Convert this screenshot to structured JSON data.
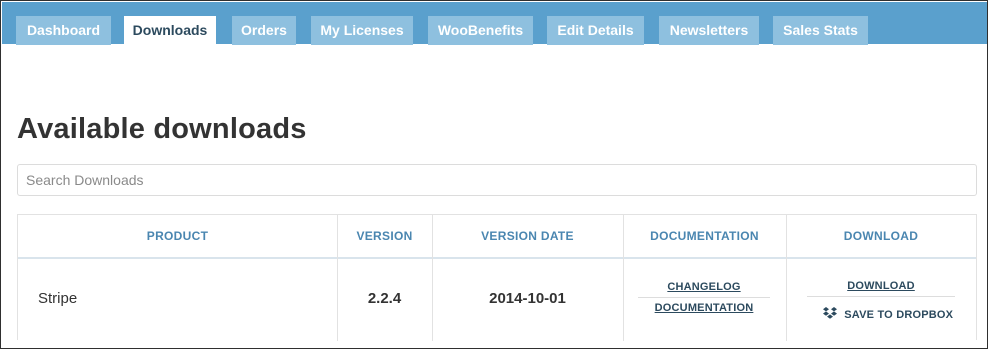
{
  "tabs": [
    {
      "label": "Dashboard"
    },
    {
      "label": "Downloads",
      "active": true
    },
    {
      "label": "Orders"
    },
    {
      "label": "My Licenses"
    },
    {
      "label": "WooBenefits"
    },
    {
      "label": "Edit Details"
    },
    {
      "label": "Newsletters"
    },
    {
      "label": "Sales Stats"
    }
  ],
  "page": {
    "title": "Available downloads"
  },
  "search": {
    "placeholder": "Search Downloads",
    "value": ""
  },
  "table": {
    "headers": {
      "product": "PRODUCT",
      "version": "VERSION",
      "version_date": "VERSION DATE",
      "documentation": "DOCUMENTATION",
      "download": "DOWNLOAD"
    },
    "rows": [
      {
        "product": "Stripe",
        "version": "2.2.4",
        "version_date": "2014-10-01",
        "doc_links": {
          "changelog": "CHANGELOG",
          "documentation": "DOCUMENTATION"
        },
        "download_links": {
          "download": "DOWNLOAD",
          "dropbox": "SAVE TO DROPBOX",
          "dropbox_icon": "dropbox-icon"
        }
      }
    ]
  },
  "colors": {
    "tabbar": "#5aa0cd",
    "tab_inactive": "#8ec0df",
    "tab_active_text": "#2c4a5e",
    "header_text": "#4a86b0",
    "link": "#2c4a5e"
  }
}
